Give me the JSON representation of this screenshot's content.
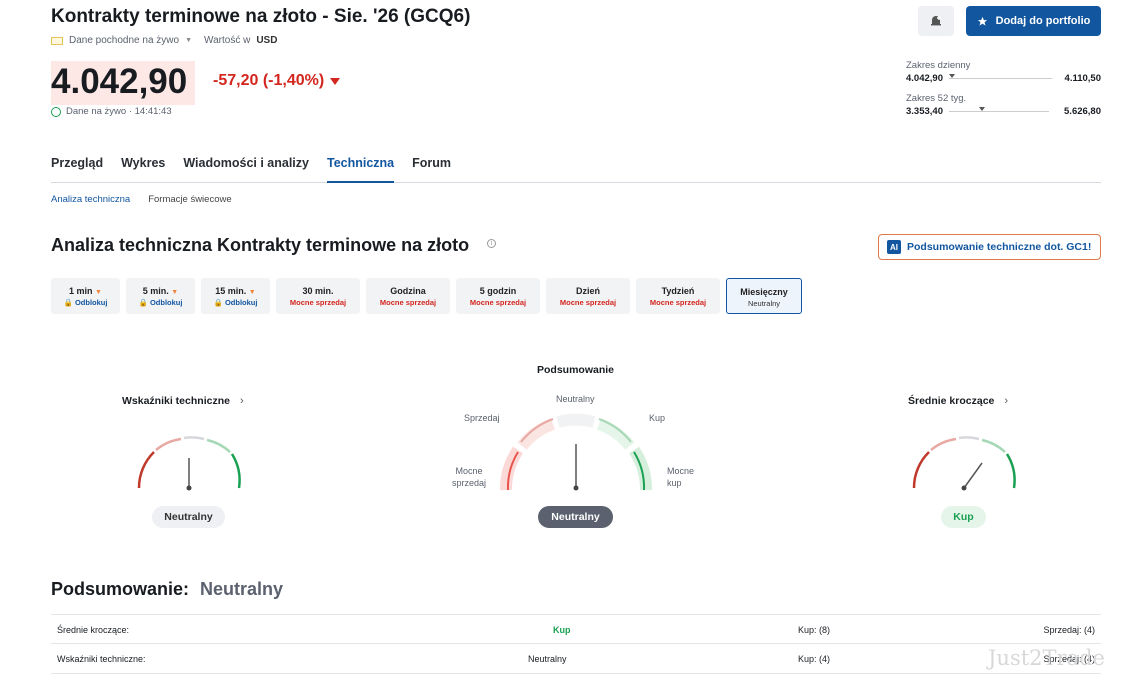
{
  "header": {
    "title": "Kontrakty terminowe na złoto - Sie. '26 (GCQ6)",
    "data_source": "Dane pochodne na żywo",
    "currency_label": "Wartość w",
    "currency": "USD",
    "add_portfolio": "Dodaj do portfolio"
  },
  "quote": {
    "price": "4.042,90",
    "change": "-57,20 (-1,40%)",
    "live_label": "Dane na żywo · 14:41:43",
    "day_range_label": "Zakres dzienny",
    "day_low": "4.042,90",
    "day_high": "4.110,50",
    "day_position": 0.0,
    "week52_label": "Zakres 52 tyg.",
    "week52_low": "3.353,40",
    "week52_high": "5.626,80",
    "week52_position": 0.3
  },
  "tabs": [
    "Przegląd",
    "Wykres",
    "Wiadomości i analizy",
    "Techniczna",
    "Forum"
  ],
  "active_tab": "Techniczna",
  "subtabs": [
    "Analiza techniczna",
    "Formacje świecowe"
  ],
  "section_title": "Analiza techniczna Kontrakty terminowe na złoto",
  "ai_button": "Podsumowanie techniczne dot. GC1!",
  "ai_icon": "AI",
  "timeframes": [
    {
      "label": "1 min",
      "status": "Odblokuj",
      "kind": "unlock"
    },
    {
      "label": "5 min.",
      "status": "Odblokuj",
      "kind": "unlock"
    },
    {
      "label": "15 min.",
      "status": "Odblokuj",
      "kind": "unlock"
    },
    {
      "label": "30 min.",
      "status": "Mocne sprzedaj",
      "kind": "sell"
    },
    {
      "label": "Godzina",
      "status": "Mocne sprzedaj",
      "kind": "sell"
    },
    {
      "label": "5 godzin",
      "status": "Mocne sprzedaj",
      "kind": "sell"
    },
    {
      "label": "Dzień",
      "status": "Mocne sprzedaj",
      "kind": "sell"
    },
    {
      "label": "Tydzień",
      "status": "Mocne sprzedaj",
      "kind": "sell"
    },
    {
      "label": "Miesięczny",
      "status": "Neutralny",
      "kind": "neutral"
    }
  ],
  "gauges": {
    "left": {
      "title": "Wskaźniki techniczne",
      "result": "Neutralny"
    },
    "center": {
      "title": "Podsumowanie",
      "result": "Neutralny",
      "labels": {
        "neutral": "Neutralny",
        "sell": "Sprzedaj",
        "buy": "Kup",
        "strong_sell": "Mocne sprzedaj",
        "strong_buy": "Mocne kup"
      }
    },
    "right": {
      "title": "Średnie kroczące",
      "result": "Kup"
    }
  },
  "summary": {
    "label": "Podsumowanie:",
    "value": "Neutralny",
    "rows": [
      {
        "name": "Średnie kroczące:",
        "signal": "Kup",
        "buy": "Kup: (8)",
        "sell": "Sprzedaj: (4)"
      },
      {
        "name": "Wskaźniki techniczne:",
        "signal": "Neutralny",
        "buy": "Kup: (4)",
        "sell": "Sprzedaj: (4)"
      }
    ]
  },
  "watermark": "Just2Trade",
  "colors": {
    "accent": "#1256a0",
    "sell": "#d3261f",
    "buy": "#1aa053"
  }
}
